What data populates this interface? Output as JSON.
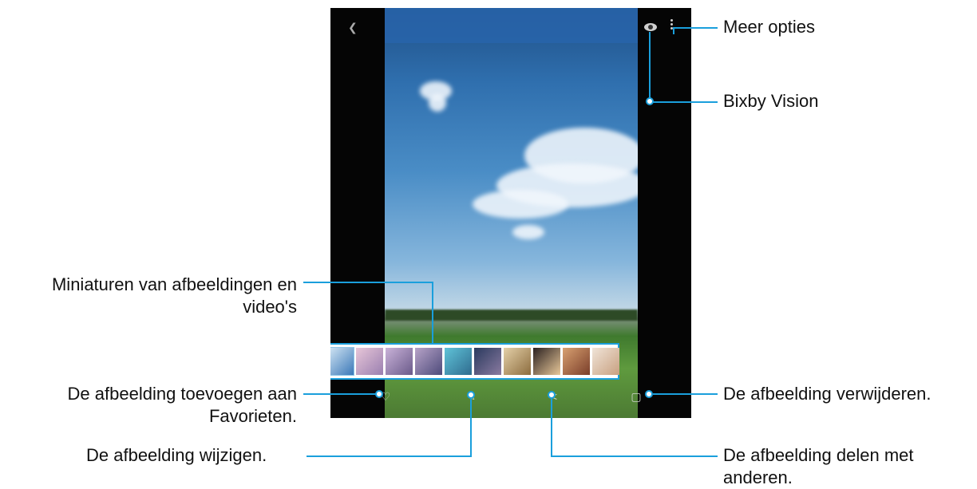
{
  "annotations": {
    "more_options": "Meer opties",
    "bixby_vision": "Bixby Vision",
    "thumbnails_line1": "Miniaturen van afbeeldingen en",
    "thumbnails_line2": "video's",
    "favorite_line1": "De afbeelding toevoegen aan",
    "favorite_line2": "Favorieten.",
    "edit": "De afbeelding wijzigen.",
    "delete": "De afbeelding verwijderen.",
    "share_line1": "De afbeelding delen met",
    "share_line2": "anderen."
  },
  "icons": {
    "back": "back-arrow-icon",
    "bixby": "bixby-vision-icon",
    "more": "more-options-icon",
    "favorite": "heart-icon",
    "edit": "pencil-icon",
    "share": "share-icon",
    "delete": "trash-icon"
  },
  "colors": {
    "accent": "#1a9fdc"
  },
  "thumbnails": [
    {
      "colors": [
        "#cfe3f2",
        "#3b78b8"
      ]
    },
    {
      "colors": [
        "#e7c6d8",
        "#9a7fb0"
      ]
    },
    {
      "colors": [
        "#c9b2d8",
        "#6a5a8a"
      ]
    },
    {
      "colors": [
        "#b7a3c8",
        "#4d4a7a"
      ]
    },
    {
      "colors": [
        "#5fc3d8",
        "#2f6b8e"
      ]
    },
    {
      "colors": [
        "#2a3a5e",
        "#8a7aa0"
      ]
    },
    {
      "colors": [
        "#e4d0a8",
        "#8c6c3e"
      ]
    },
    {
      "colors": [
        "#2a2020",
        "#e8c89a"
      ]
    },
    {
      "colors": [
        "#d8a070",
        "#7a3e2a"
      ]
    },
    {
      "colors": [
        "#f0e4d8",
        "#c8a080"
      ]
    }
  ]
}
